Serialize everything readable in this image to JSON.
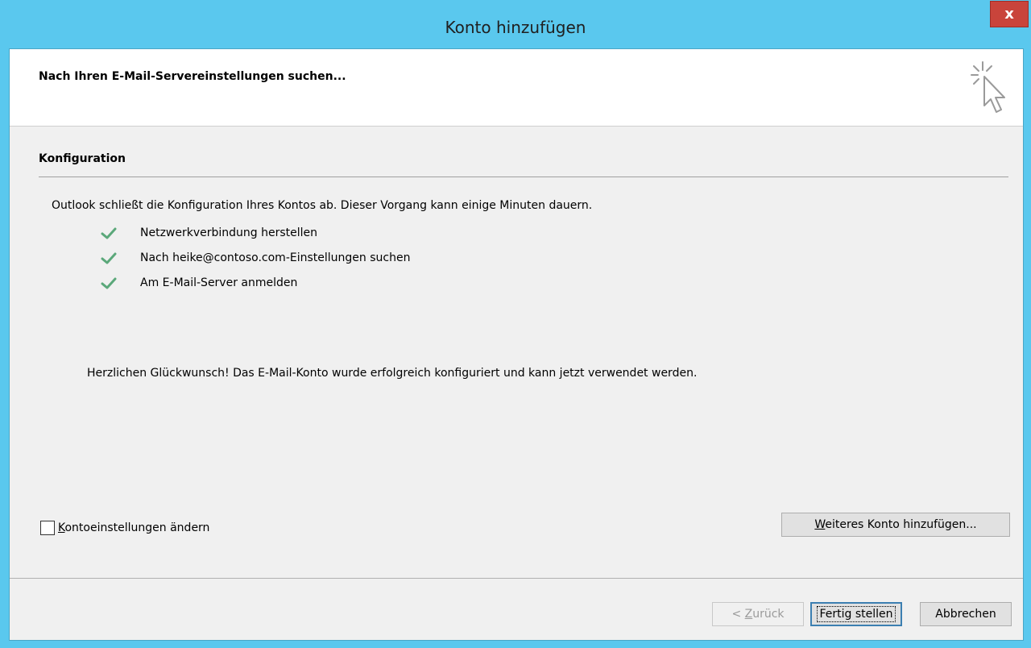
{
  "window": {
    "title": "Konto hinzufügen",
    "close_label": "x"
  },
  "header": {
    "title": "Nach Ihren E-Mail-Servereinstellungen suchen...",
    "icon": "cursor-sparkle-icon"
  },
  "section": {
    "label": "Konfiguration",
    "intro": "Outlook schließt die Konfiguration Ihres Kontos ab. Dieser Vorgang kann einige Minuten dauern.",
    "steps": [
      {
        "label": "Netzwerkverbindung herstellen",
        "status": "done"
      },
      {
        "label": "Nach heike@contoso.com-Einstellungen suchen",
        "status": "done"
      },
      {
        "label": "Am E-Mail-Server anmelden",
        "status": "done"
      }
    ],
    "congrats": "Herzlichen Glückwunsch! Das E-Mail-Konto wurde erfolgreich konfiguriert und kann jetzt verwendet werden."
  },
  "options": {
    "change_settings_label_first": "K",
    "change_settings_label_rest": "ontoeinstellungen ändern",
    "change_settings_checked": false,
    "add_another_first": "W",
    "add_another_rest": "eiteres Konto hinzufügen..."
  },
  "footer": {
    "back_prefix": "< ",
    "back_underline": "Z",
    "back_rest": "urück",
    "finish_label": "Fertig stellen",
    "cancel_label": "Abbrechen"
  },
  "colors": {
    "titlebar": "#5ac8ee",
    "close": "#c9443b",
    "check": "#5ba87a"
  }
}
